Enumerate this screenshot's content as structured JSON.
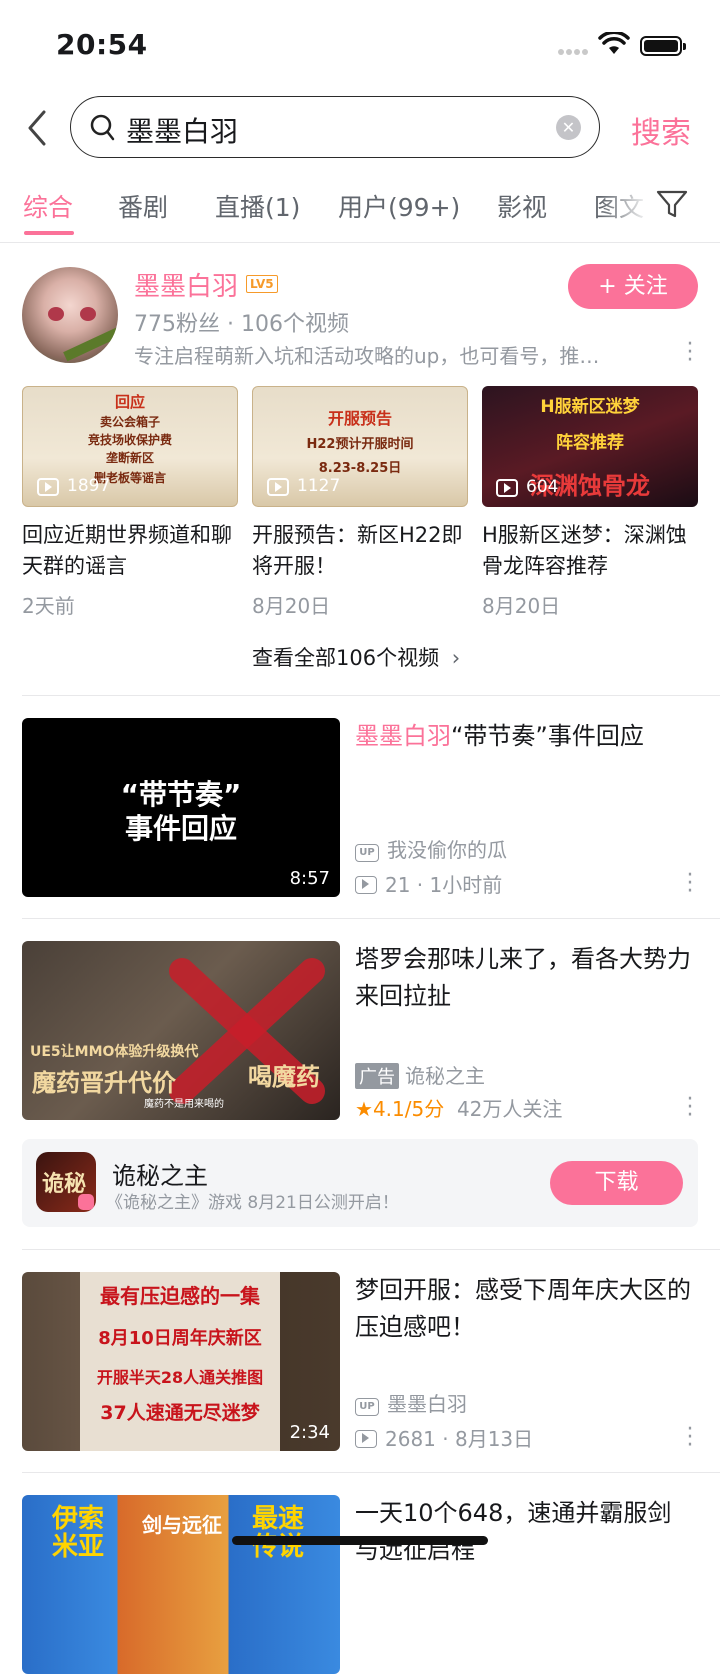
{
  "status_bar": {
    "time": "20:54"
  },
  "search": {
    "query": "墨墨白羽",
    "button_label": "搜索"
  },
  "tabs": [
    {
      "label": "综合",
      "active": true
    },
    {
      "label": "番剧"
    },
    {
      "label": "直播(1)"
    },
    {
      "label": "用户(99+)"
    },
    {
      "label": "影视"
    },
    {
      "label": "图文"
    }
  ],
  "user_card": {
    "name": "墨墨白羽",
    "level": "LV5",
    "stats": "775粉丝 · 106个视频",
    "description": "专注启程萌新入坑和活动攻略的up，也可看号，推…",
    "follow_label": "+ 关注",
    "videos": [
      {
        "thumb_lines": [
          "回应",
          "卖公会箱子",
          "竞技场收保护费",
          "垄断新区",
          "删老板等谣言"
        ],
        "views": "1897",
        "title": "回应近期世界频道和聊天群的谣言",
        "date": "2天前"
      },
      {
        "thumb_lines": [
          "开服预告",
          "H22预计开服时间",
          "8.23-8.25日"
        ],
        "views": "1127",
        "title": "开服预告：新区H22即将开服！",
        "date": "8月20日"
      },
      {
        "thumb_lines": [
          "H服新区迷梦",
          "阵容推荐",
          "深渊蚀骨龙"
        ],
        "views": "604",
        "title": "H服新区迷梦：深渊蚀骨龙阵容推荐",
        "date": "8月20日"
      }
    ],
    "view_all": "查看全部106个视频"
  },
  "results": [
    {
      "title_highlight": "墨墨白羽",
      "title_rest": "“带节奏”事件回应",
      "thumb_lines": [
        "“带节奏”",
        "事件回应"
      ],
      "duration": "8:57",
      "author": "我没偷你的瓜",
      "views": "21",
      "time": "1小时前"
    },
    {
      "title": "塔罗会那味儿来了，看各大势力来回拉扯",
      "thumb_lines": [
        "UE5让MMO体验升级换代",
        "魔药晋升代价",
        "喝魔药",
        "魔药不是用来喝的"
      ],
      "ad_label": "广告",
      "author": "诡秘之主",
      "rating": "4.1/5分",
      "followers": "42万人关注"
    },
    {
      "title": "梦回开服：感受下周年庆大区的压迫感吧！",
      "thumb_lines": [
        "最有压迫感的一集",
        "8月10日周年庆新区",
        "开服半天28人通关推图",
        "37人速通无尽迷梦"
      ],
      "duration": "2:34",
      "author": "墨墨白羽",
      "views": "2681",
      "time": "8月13日"
    },
    {
      "title": "一天10个648，速通并霸服剑与远征启程",
      "thumb_lines": [
        "伊索米亚",
        "剑与远征",
        "最速传说"
      ]
    }
  ],
  "game_card": {
    "name": "诡秘之主",
    "description": "《诡秘之主》游戏 8月21日公测开启！",
    "icon_text": "诡秘",
    "download_label": "下载"
  },
  "colors": {
    "accent": "#fb7299",
    "secondary_text": "#9499a0",
    "rating": "#fb8c00"
  }
}
